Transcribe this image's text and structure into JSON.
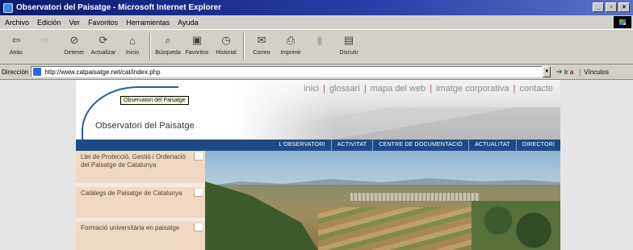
{
  "window": {
    "title": "Observatori del Paisatge - Microsoft Internet Explorer",
    "controls": [
      "_",
      "▫",
      "×"
    ]
  },
  "menu": [
    "Archivo",
    "Edición",
    "Ver",
    "Favoritos",
    "Herramientas",
    "Ayuda"
  ],
  "toolbar": {
    "back": "Atrás",
    "forward": "",
    "stop": "Detener",
    "refresh": "Actualizar",
    "home": "Inicio",
    "search": "Búsqueda",
    "favorites": "Favoritos",
    "history": "Historial",
    "mail": "Correo",
    "print": "Imprimir",
    "edit": "",
    "discuss": "Discutir"
  },
  "address": {
    "label": "Dirección",
    "url": "http://www.catpaisatge.net/cat/index.php",
    "go": "Ir a",
    "links": "Vínculos"
  },
  "site": {
    "name": "Observatori del Paisatge",
    "tooltip": "Observatori del Paisatge",
    "toplinks": [
      "inici",
      "glossari",
      "mapa del web",
      "imatge corporativa",
      "contacte"
    ],
    "nav": [
      "L'OBSERVATORI",
      "ACTIVITAT",
      "CENTRE DE DOCUMENTACIÓ",
      "ACTUALITAT",
      "DIRECTORI"
    ],
    "sidebar": [
      "Llei de Protecció, Gestió i Ordenació del Paisatge de Catalunya",
      "Catàlegs de Paisatge de Catalunya",
      "Formació universitària en paisatge"
    ]
  }
}
